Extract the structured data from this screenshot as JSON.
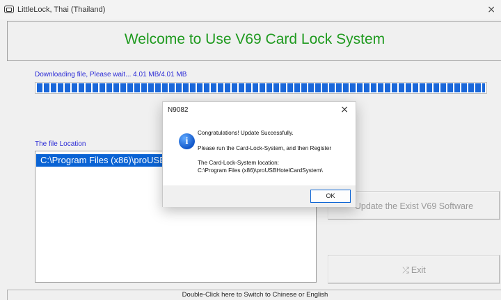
{
  "window": {
    "title": "LittleLock, Thai (Thailand)",
    "close_glyph": "×"
  },
  "header": {
    "heading": "Welcome to Use V69 Card Lock System",
    "heading_color": "#1f9a1f"
  },
  "download": {
    "status": "Downloading file, Please wait... 4.01 MB/4.01 MB",
    "progress": 1.0,
    "bar_color": "#1a67d9"
  },
  "location": {
    "label": "The file Location",
    "selected_item": "C:\\Program Files (x86)\\proUSBHotelCardSystem\\"
  },
  "buttons": {
    "update": "Update the Exist V69 Software",
    "exit": "Exit",
    "exit_icon": "exit-icon"
  },
  "statusbar": {
    "text": "Double-Click here to Switch to Chinese or English"
  },
  "dialog": {
    "title": "N9082",
    "close_glyph": "×",
    "icon": "info-icon",
    "line1": "Congratulations! Update Successfully.",
    "line2": "Please run the Card-Lock-System, and then Register",
    "line3": "The Card-Lock-System location:",
    "line4": "C:\\Program Files (x86)\\proUSBHotelCardSystem\\",
    "ok_label": "OK"
  },
  "colors": {
    "accent": "#0a63d4",
    "link_text": "#2b2bd6"
  }
}
